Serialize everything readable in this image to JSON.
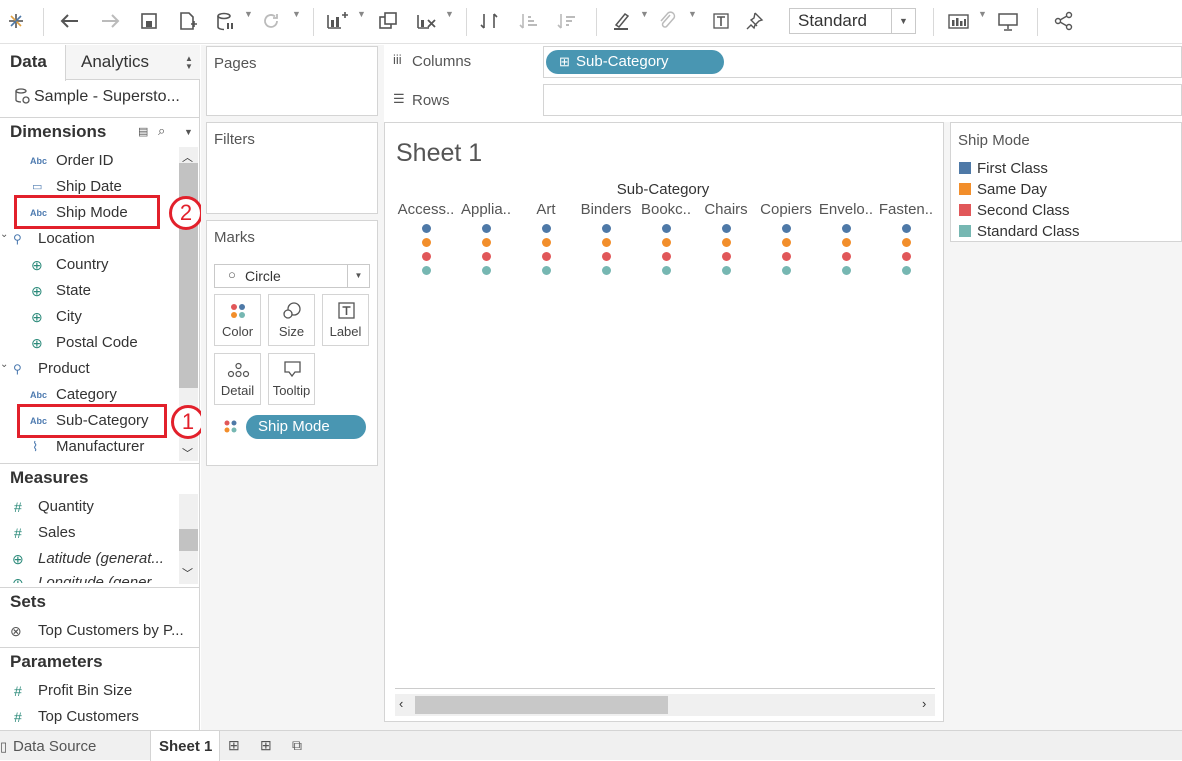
{
  "toolbar": {
    "fit_value": "Standard"
  },
  "data_pane": {
    "tab_data": "Data",
    "tab_analytics": "Analytics",
    "datasource": "Sample - Supersto...",
    "dimensions_title": "Dimensions",
    "dimensions": {
      "order_id": "Order ID",
      "ship_date": "Ship Date",
      "ship_mode": "Ship Mode",
      "location": "Location",
      "country": "Country",
      "state": "State",
      "city": "City",
      "postal_code": "Postal Code",
      "product": "Product",
      "category": "Category",
      "sub_category": "Sub-Category",
      "manufacturer": "Manufacturer"
    },
    "abc": "Abc",
    "measures_title": "Measures",
    "measures": {
      "quantity": "Quantity",
      "sales": "Sales",
      "latitude": "Latitude (generat...",
      "longitude": "Longitude (gener..."
    },
    "sets_title": "Sets",
    "sets": {
      "top_customers_by": "Top Customers by P..."
    },
    "parameters_title": "Parameters",
    "parameters": {
      "profit_bin_size": "Profit Bin Size",
      "top_customers": "Top Customers"
    }
  },
  "cards": {
    "pages": "Pages",
    "filters": "Filters",
    "marks": "Marks",
    "mark_type": "Circle",
    "color": "Color",
    "size": "Size",
    "label": "Label",
    "detail": "Detail",
    "tooltip": "Tooltip",
    "ship_mode_pill": "Ship Mode"
  },
  "shelves": {
    "columns": "Columns",
    "rows": "Rows",
    "columns_pill": "Sub-Category"
  },
  "view": {
    "sheet_title": "Sheet 1",
    "axis_header": "Sub-Category",
    "columns": [
      "Access..",
      "Applia..",
      "Art",
      "Binders",
      "Bookc..",
      "Chairs",
      "Copiers",
      "Envelo..",
      "Fasten.."
    ]
  },
  "legend": {
    "title": "Ship Mode",
    "items": [
      {
        "label": "First Class",
        "color": "#4e79a7"
      },
      {
        "label": "Same Day",
        "color": "#f28e2b"
      },
      {
        "label": "Second Class",
        "color": "#e15759"
      },
      {
        "label": "Standard Class",
        "color": "#76b7b2"
      }
    ]
  },
  "bottom": {
    "data_source": "Data Source",
    "sheet1": "Sheet 1"
  },
  "annotations": {
    "one": "1",
    "two": "2"
  }
}
